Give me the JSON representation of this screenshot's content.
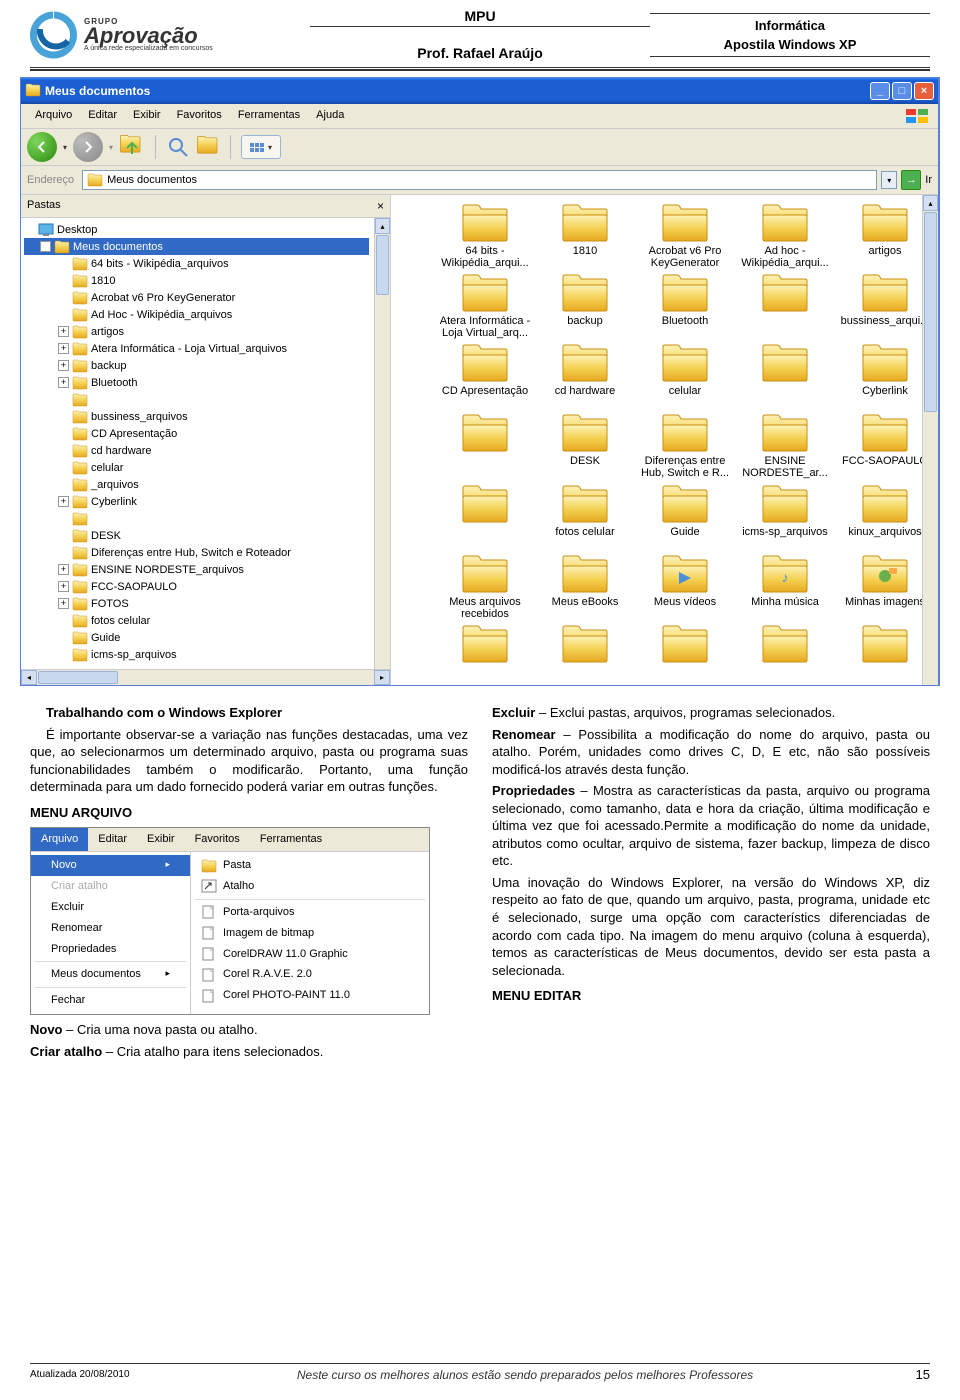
{
  "header": {
    "logo_grupo": "GRUPO",
    "logo_main": "Aprovação",
    "logo_sub": "A única rede especializada em concursos",
    "mpu": "MPU",
    "prof": "Prof. Rafael Araújo",
    "info1": "Informática",
    "info2": "Apostila Windows XP"
  },
  "explorer": {
    "title": "Meus documentos",
    "menus": [
      "Arquivo",
      "Editar",
      "Exibir",
      "Favoritos",
      "Ferramentas",
      "Ajuda"
    ],
    "address_label": "Endereço",
    "address_value": "Meus documentos",
    "go_label": "Ir",
    "tree_header": "Pastas",
    "tree": [
      {
        "ind": 1,
        "exp": "",
        "icon": "desktop",
        "label": "Desktop"
      },
      {
        "ind": 2,
        "exp": "-",
        "icon": "folder",
        "label": "Meus documentos",
        "sel": true
      },
      {
        "ind": 3,
        "exp": "",
        "icon": "folder",
        "label": "64 bits - Wikipédia_arquivos"
      },
      {
        "ind": 3,
        "exp": "",
        "icon": "folder",
        "label": "1810"
      },
      {
        "ind": 3,
        "exp": "",
        "icon": "folder",
        "label": "Acrobat v6 Pro KeyGenerator"
      },
      {
        "ind": 3,
        "exp": "",
        "icon": "folder",
        "label": "Ad Hoc - Wikipédia_arquivos"
      },
      {
        "ind": 3,
        "exp": "+",
        "icon": "folder",
        "label": "artigos"
      },
      {
        "ind": 3,
        "exp": "+",
        "icon": "folder",
        "label": "Atera Informática - Loja Virtual_arquivos"
      },
      {
        "ind": 3,
        "exp": "+",
        "icon": "folder",
        "label": "backup"
      },
      {
        "ind": 3,
        "exp": "+",
        "icon": "folder",
        "label": "Bluetooth"
      },
      {
        "ind": 3,
        "exp": "",
        "icon": "folder",
        "label": ""
      },
      {
        "ind": 3,
        "exp": "",
        "icon": "folder",
        "label": "bussiness_arquivos"
      },
      {
        "ind": 3,
        "exp": "",
        "icon": "folder",
        "label": "CD Apresentação"
      },
      {
        "ind": 3,
        "exp": "",
        "icon": "folder",
        "label": "cd hardware"
      },
      {
        "ind": 3,
        "exp": "",
        "icon": "folder",
        "label": "celular"
      },
      {
        "ind": 3,
        "exp": "",
        "icon": "folder",
        "label": "_arquivos"
      },
      {
        "ind": 3,
        "exp": "+",
        "icon": "folder",
        "label": "Cyberlink"
      },
      {
        "ind": 3,
        "exp": "",
        "icon": "folder",
        "label": ""
      },
      {
        "ind": 3,
        "exp": "",
        "icon": "folder",
        "label": "DESK"
      },
      {
        "ind": 3,
        "exp": "",
        "icon": "folder",
        "label": "Diferenças entre Hub, Switch e Roteador"
      },
      {
        "ind": 3,
        "exp": "+",
        "icon": "folder",
        "label": "ENSINE NORDESTE_arquivos"
      },
      {
        "ind": 3,
        "exp": "+",
        "icon": "folder",
        "label": "FCC-SAOPAULO"
      },
      {
        "ind": 3,
        "exp": "+",
        "icon": "folder",
        "label": "FOTOS"
      },
      {
        "ind": 3,
        "exp": "",
        "icon": "folder",
        "label": "fotos celular"
      },
      {
        "ind": 3,
        "exp": "",
        "icon": "folder",
        "label": "Guide"
      },
      {
        "ind": 3,
        "exp": "",
        "icon": "folder",
        "label": "icms-sp_arquivos"
      }
    ],
    "icons": [
      "64 bits - Wikipédia_arqui...",
      "1810",
      "Acrobat v6 Pro KeyGenerator",
      "Ad hoc - Wikipédia_arqui...",
      "artigos",
      "Atera Informática - Loja Virtual_arq...",
      "backup",
      "Bluetooth",
      "",
      "bussiness_arqui...",
      "CD Apresentação",
      "cd hardware",
      "celular",
      "",
      "Cyberlink",
      "",
      "DESK",
      "Diferenças entre Hub, Switch e R...",
      "ENSINE NORDESTE_ar...",
      "FCC-SAOPAULO",
      "",
      "fotos celular",
      "Guide",
      "icms-sp_arquivos",
      "kinux_arquivos",
      "Meus arquivos recebidos",
      "Meus eBooks",
      "Meus vídeos",
      "Minha música",
      "Minhas imagens",
      "",
      "",
      "",
      "",
      ""
    ]
  },
  "text": {
    "left_title": "Trabalhando com o Windows Explorer",
    "left_p1": "É importante observar-se a variação nas funções destacadas, uma vez que, ao selecionarmos um determinado arquivo, pasta ou programa suas funcionabilidades também o modificarão. Portanto, uma função determinada para um dado fornecido poderá variar em outras funções.",
    "left_h4": "MENU ARQUIVO",
    "left_p2a": "Novo",
    "left_p2b": " – Cria uma nova pasta ou atalho.",
    "left_p3a": "Criar atalho",
    "left_p3b": " – Cria atalho para itens selecionados.",
    "r1a": "Excluir",
    "r1b": " – Exclui pastas, arquivos, programas selecionados.",
    "r2a": "Renomear",
    "r2b": " – Possibilita a modificação do nome do arquivo, pasta ou atalho. Porém, unidades como drives C, D, E etc, não são possíveis modificá-los através desta função.",
    "r3a": "Propriedades",
    "r3b": " – Mostra as características  da pasta, arquivo ou programa selecionado, como tamanho, data e hora da criação, última modificação e última vez que foi acessado.Permite a modificação do nome da unidade, atributos como ocultar, arquivo de sistema, fazer backup, limpeza de disco etc.",
    "r4": "Uma inovação do Windows Explorer, na versão do Windows XP, diz respeito ao fato de que, quando um arquivo, pasta, programa, unidade etc é selecionado, surge uma opção com característics diferenciadas de acordo com cada tipo. Na imagem do menu arquivo (coluna à esquerda), temos as características de Meus documentos, devido ser esta pasta a selecionada.",
    "r_h4": "MENU EDITAR"
  },
  "menu_shot": {
    "bar": [
      "Arquivo",
      "Editar",
      "Exibir",
      "Favoritos",
      "Ferramentas"
    ],
    "left": [
      {
        "t": "Novo",
        "hl": true,
        "arrow": true
      },
      {
        "t": "Criar atalho",
        "dis": true
      },
      {
        "t": "Excluir"
      },
      {
        "t": "Renomear"
      },
      {
        "t": "Propriedades"
      },
      {
        "sep": true
      },
      {
        "t": "Meus documentos",
        "arrow": true
      },
      {
        "sep": true
      },
      {
        "t": "Fechar"
      }
    ],
    "right": [
      {
        "icon": "folder",
        "t": "Pasta"
      },
      {
        "icon": "shortcut",
        "t": "Atalho"
      },
      {
        "sep": true
      },
      {
        "icon": "file",
        "t": "Porta-arquivos"
      },
      {
        "icon": "file",
        "t": "Imagem de bitmap"
      },
      {
        "icon": "file",
        "t": "CorelDRAW 11.0 Graphic"
      },
      {
        "icon": "file",
        "t": "Corel R.A.V.E. 2.0"
      },
      {
        "icon": "file",
        "t": "Corel PHOTO-PAINT 11.0"
      }
    ]
  },
  "footer": {
    "date": "Atualizada 20/08/2010",
    "mid": "Neste curso os melhores alunos estão sendo preparados pelos melhores Professores",
    "page": "15"
  }
}
